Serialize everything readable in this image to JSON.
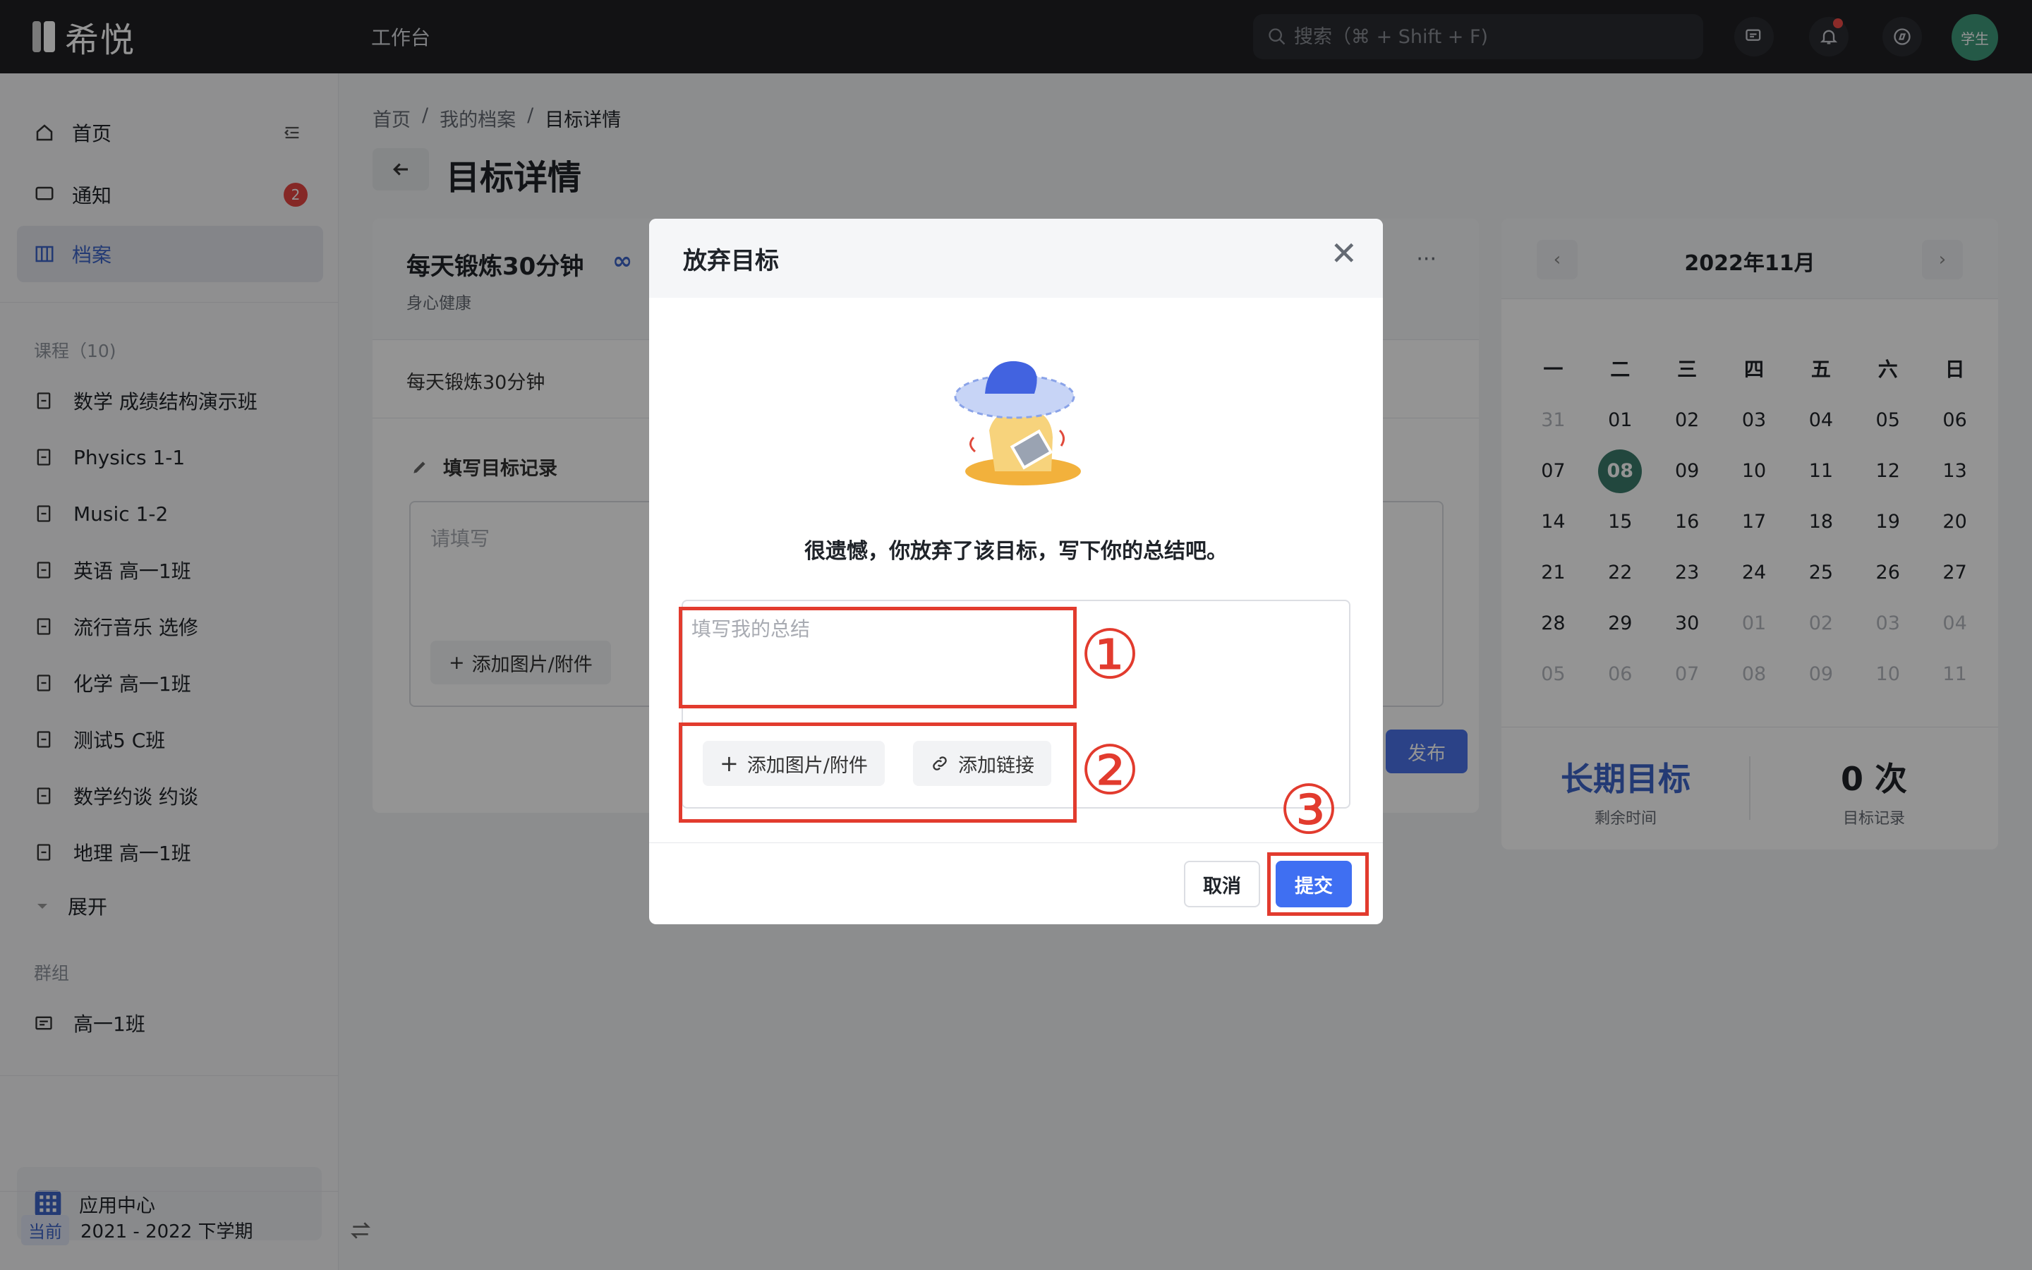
{
  "topbar": {
    "logo_text": "希悦",
    "workbench": "工作台",
    "search_placeholder": "搜索（⌘ + Shift + F)",
    "avatar_text": "学生"
  },
  "sidebar": {
    "nav": [
      {
        "label": "首页"
      },
      {
        "label": "通知",
        "badge": "2"
      },
      {
        "label": "档案"
      }
    ],
    "courses_title": "课程（10)",
    "courses": [
      "数学 成绩结构演示班",
      "Physics 1-1",
      "Music 1-2",
      "英语 高一1班",
      "流行音乐 选修",
      "化学 高一1班",
      "测试5 C班",
      "数学约谈 约谈",
      "地理 高一1班"
    ],
    "expand": "展开",
    "groups_title": "群组",
    "groups": [
      "高一1班"
    ],
    "app_center": "应用中心",
    "term_badge": "当前",
    "term": "2021 - 2022 下学期"
  },
  "main": {
    "breadcrumb": [
      "首页",
      "我的档案",
      "目标详情"
    ],
    "title": "目标详情",
    "goal_name": "每天锻炼30分钟",
    "goal_category": "身心健康",
    "goal_desc": "每天锻炼30分钟",
    "record_title": "填写目标记录",
    "record_placeholder": "请填写",
    "add_attachment": "添加图片/附件",
    "publish": "发布"
  },
  "calendar": {
    "month": "2022年11月",
    "weekdays": [
      "一",
      "二",
      "三",
      "四",
      "五",
      "六",
      "日"
    ],
    "weeks": [
      [
        "31",
        "01",
        "02",
        "03",
        "04",
        "05",
        "06"
      ],
      [
        "07",
        "08",
        "09",
        "10",
        "11",
        "12",
        "13"
      ],
      [
        "14",
        "15",
        "16",
        "17",
        "18",
        "19",
        "20"
      ],
      [
        "21",
        "22",
        "23",
        "24",
        "25",
        "26",
        "27"
      ],
      [
        "28",
        "29",
        "30",
        "01",
        "02",
        "03",
        "04"
      ],
      [
        "05",
        "06",
        "07",
        "08",
        "09",
        "10",
        "11"
      ]
    ],
    "today": "08",
    "stat_left_value": "长期目标",
    "stat_left_label": "剩余时间",
    "stat_right_value": "0 次",
    "stat_right_label": "目标记录",
    "colors": {
      "today": "#3c7a6b",
      "stat_left": "#3d64c9"
    }
  },
  "modal": {
    "title": "放弃目标",
    "message": "很遗憾，你放弃了该目标，写下你的总结吧。",
    "summary_placeholder": "填写我的总结",
    "add_attachment": "添加图片/附件",
    "add_link": "添加链接",
    "cancel": "取消",
    "submit": "提交"
  },
  "annotations": [
    "①",
    "②",
    "③"
  ],
  "colors": {
    "accent": "#3f6ff2",
    "annotation": "#e23b2e",
    "badge": "#e54542"
  }
}
